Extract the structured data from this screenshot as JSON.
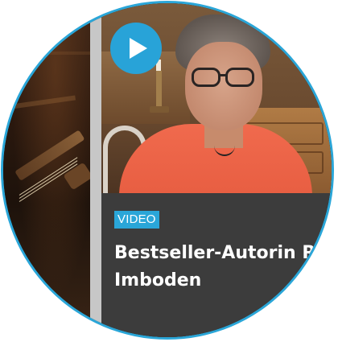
{
  "card": {
    "badge": "VIDEO",
    "title_line1": "Bestseller-Autorin R",
    "title_line2": "Imboden"
  },
  "icons": {
    "play": "play-icon"
  },
  "colors": {
    "accent": "#2aa6d8",
    "caption_bg": "#3c3c3c",
    "shirt": "#e55a3e",
    "text": "#ffffff"
  }
}
